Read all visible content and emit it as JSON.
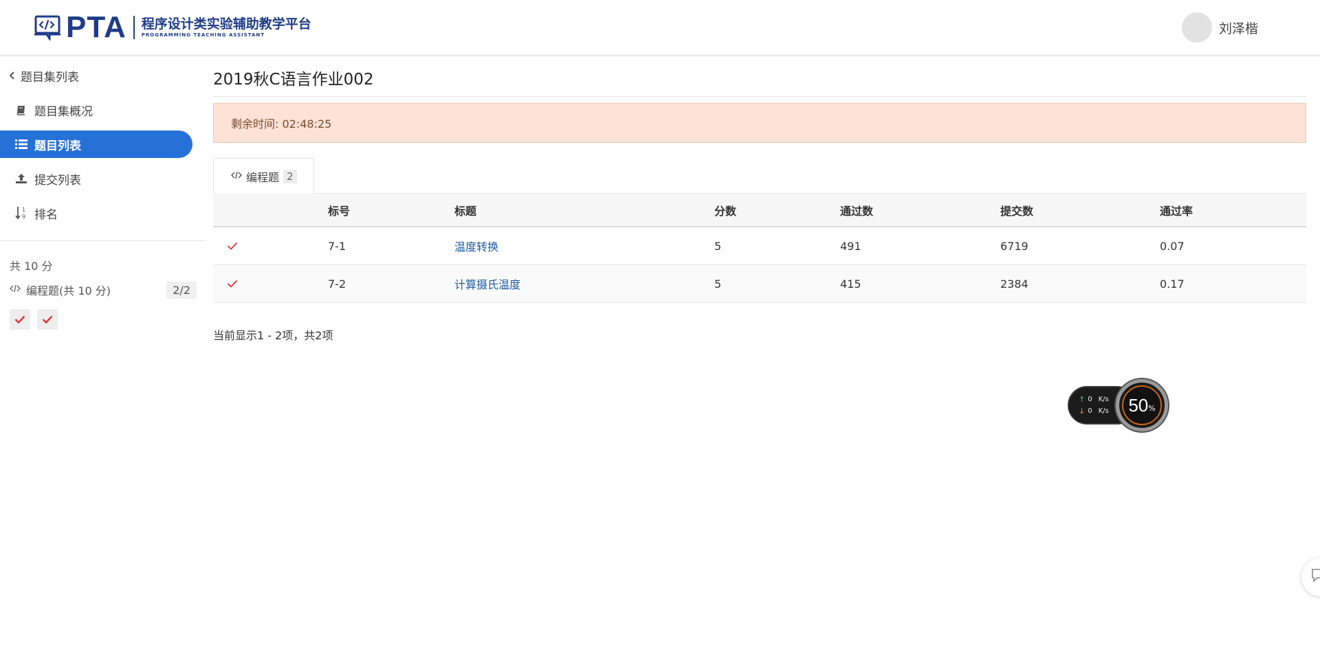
{
  "header": {
    "logo_text": "PTA",
    "logo_subtitle": "程序设计类实验辅助教学平台",
    "logo_subtitle_en": "PROGRAMMING TEACHING ASSISTANT",
    "username": "刘泽楷"
  },
  "sidebar": {
    "back_label": "题目集列表",
    "items": [
      {
        "label": "题目集概况",
        "icon": "book-icon"
      },
      {
        "label": "题目列表",
        "icon": "list-icon",
        "active": true
      },
      {
        "label": "提交列表",
        "icon": "upload-icon"
      },
      {
        "label": "排名",
        "icon": "sort-numeric-icon"
      }
    ],
    "total_score": "共 10 分",
    "section_label": "编程题(共 10 分)",
    "section_count": "2/2",
    "problem_status": [
      "solved",
      "solved"
    ]
  },
  "main": {
    "title": "2019秋C语言作业002",
    "alert": "剩余时间: 02:48:25",
    "tab": {
      "label": "编程题",
      "count": "2"
    },
    "table": {
      "headers": [
        "标号",
        "标题",
        "分数",
        "通过数",
        "提交数",
        "通过率"
      ],
      "rows": [
        {
          "status": "solved",
          "num": "7-1",
          "title": "温度转换",
          "score": "5",
          "passed": "491",
          "submitted": "6719",
          "rate": "0.07"
        },
        {
          "status": "solved",
          "num": "7-2",
          "title": "计算摄氏温度",
          "score": "5",
          "passed": "415",
          "submitted": "2384",
          "rate": "0.17"
        }
      ]
    },
    "pagination": "当前显示1 - 2项，共2项"
  },
  "speed_widget": {
    "up_value": "0",
    "up_unit": "K/s",
    "down_value": "0",
    "down_unit": "K/s",
    "gauge_value": "50",
    "gauge_unit": "%"
  },
  "colors": {
    "brand": "#1f3c88",
    "active_nav": "#2671d8",
    "alert_bg": "#fde2d5",
    "check_red": "#e0322f",
    "link": "#1f5ba6"
  }
}
